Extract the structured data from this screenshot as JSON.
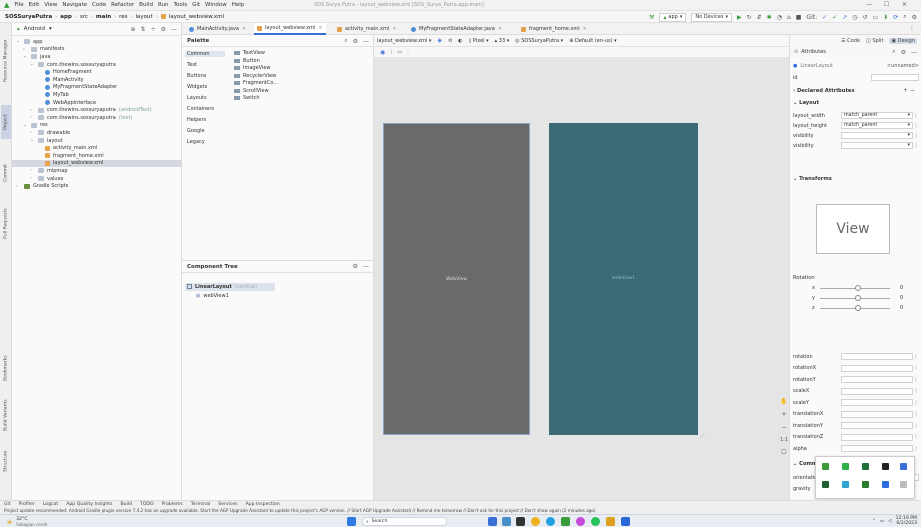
{
  "menu": {
    "items": [
      "File",
      "Edit",
      "View",
      "Navigate",
      "Code",
      "Refactor",
      "Build",
      "Run",
      "Tools",
      "Git",
      "Window",
      "Help"
    ],
    "window_title": "SOS Surya Putra - layout_webview.xml [SOS_Surya_Putra.app.main]"
  },
  "nav": {
    "crumbs": [
      "SOSSuryaPutra",
      "app",
      "src",
      "main",
      "res",
      "layout",
      "layout_webview.xml"
    ],
    "run_config": "app",
    "device": "No Devices"
  },
  "left_strip": [
    "Resource Manager",
    "Project",
    "Commit",
    "Pull Requests",
    "Structure",
    "Build Variants",
    "Bookmarks"
  ],
  "project": {
    "view_label": "Android",
    "tree": [
      {
        "label": "app",
        "depth": 0,
        "icon": "folder-icon",
        "chev": "v"
      },
      {
        "label": "manifests",
        "depth": 1,
        "icon": "folder-icon",
        "chev": ">"
      },
      {
        "label": "java",
        "depth": 1,
        "icon": "folder-icon",
        "chev": "v"
      },
      {
        "label": "com.thewins.sossuryaputra",
        "depth": 2,
        "icon": "folder-icon",
        "chev": "v"
      },
      {
        "label": "HomeFragment",
        "depth": 3,
        "icon": "class-icon",
        "chev": ""
      },
      {
        "label": "MainActivity",
        "depth": 3,
        "icon": "class-icon",
        "chev": ""
      },
      {
        "label": "MyFragmentStateAdapter",
        "depth": 3,
        "icon": "class-icon",
        "chev": ""
      },
      {
        "label": "MyTab",
        "depth": 3,
        "icon": "class-icon",
        "chev": ""
      },
      {
        "label": "WebAppInterface",
        "depth": 3,
        "icon": "class-icon",
        "chev": ""
      },
      {
        "label": "com.thewins.sossuryaputra",
        "muted": "(androidTest)",
        "depth": 2,
        "icon": "folder-icon",
        "chev": ">"
      },
      {
        "label": "com.thewins.sossuryaputra",
        "muted": "(test)",
        "depth": 2,
        "icon": "folder-icon",
        "chev": ">"
      },
      {
        "label": "res",
        "depth": 1,
        "icon": "folder-icon",
        "chev": "v"
      },
      {
        "label": "drawable",
        "depth": 2,
        "icon": "folder-icon",
        "chev": ">"
      },
      {
        "label": "layout",
        "depth": 2,
        "icon": "folder-icon",
        "chev": "v"
      },
      {
        "label": "activity_main.xml",
        "depth": 3,
        "icon": "xml-icon",
        "chev": ""
      },
      {
        "label": "fragment_home.xml",
        "depth": 3,
        "icon": "xml-icon",
        "chev": ""
      },
      {
        "label": "layout_webview.xml",
        "depth": 3,
        "icon": "xml-icon",
        "chev": "",
        "selected": true
      },
      {
        "label": "mipmap",
        "depth": 2,
        "icon": "folder-icon",
        "chev": ">"
      },
      {
        "label": "values",
        "depth": 2,
        "icon": "folder-icon",
        "chev": ">"
      },
      {
        "label": "Gradle Scripts",
        "depth": 0,
        "icon": "gradle-icon",
        "chev": ">"
      }
    ]
  },
  "editor_tabs": [
    "MainActivity.java",
    "layout_webview.xml",
    "activity_main.xml",
    "MyFragmentStateAdapter.java",
    "fragment_home.xml"
  ],
  "palette": {
    "title": "Palette",
    "categories": [
      "Common",
      "Text",
      "Buttons",
      "Widgets",
      "Layouts",
      "Containers",
      "Helpers",
      "Google",
      "Legacy"
    ],
    "items": [
      "TextView",
      "Button",
      "ImageView",
      "RecyclerView",
      "FragmentCo...",
      "ScrollView",
      "Switch"
    ]
  },
  "component_tree": {
    "title": "Component Tree",
    "root": "LinearLayout",
    "root_muted": "(vertical)",
    "child": "webView1"
  },
  "design_bar": {
    "file": "layout_webview.xml",
    "device": "Pixel",
    "api": "33",
    "theme": "SOSSuryaPutra",
    "locale": "Default (en-us)"
  },
  "view_modes": [
    "Code",
    "Split",
    "Design"
  ],
  "canvas": {
    "label_design": "WebView",
    "label_blueprint": "webView1"
  },
  "attributes": {
    "title": "Attributes",
    "class": "LinearLayout",
    "unnamed": "<unnamed>",
    "id_label": "id",
    "declared": "Declared Attributes",
    "layout_sec": "Layout",
    "rows": [
      {
        "label": "layout_width",
        "value": "match_parent"
      },
      {
        "label": "layout_height",
        "value": "match_parent"
      },
      {
        "label": "visibility",
        "value": ""
      },
      {
        "label": "visibility",
        "value": ""
      }
    ],
    "transforms": "Transforms",
    "view_preview": "View",
    "rotation": "Rotation",
    "axes": [
      {
        "axis": "x",
        "value": "0"
      },
      {
        "axis": "y",
        "value": "0"
      },
      {
        "axis": "z",
        "value": "0"
      }
    ],
    "props": [
      "rotation",
      "rotationX",
      "rotationY",
      "scaleX",
      "scaleY",
      "translationX",
      "translationY",
      "translationZ",
      "alpha"
    ],
    "common": "Common Attributes",
    "common_rows": [
      "orientation",
      "gravity"
    ]
  },
  "bottom_tools": [
    "Git",
    "Profiler",
    "Logcat",
    "App Quality Insights",
    "Build",
    "TODO",
    "Problems",
    "Terminal",
    "Services",
    "App Inspection"
  ],
  "status": "Project update recommended: Android Gradle plugin version 7.4.2 has an upgrade available. Start the AGP Upgrade Assistant to update this project's AGP version. // Start AGP Upgrade Assistant // Remind me tomorrow // Don't ask for this project // Don't show again (2 minutes ago)",
  "taskbar": {
    "temp": "32°C",
    "weather": "Sebagian cerah",
    "search": "Search",
    "time": "12:19 PM",
    "date": "6/2/2023"
  }
}
